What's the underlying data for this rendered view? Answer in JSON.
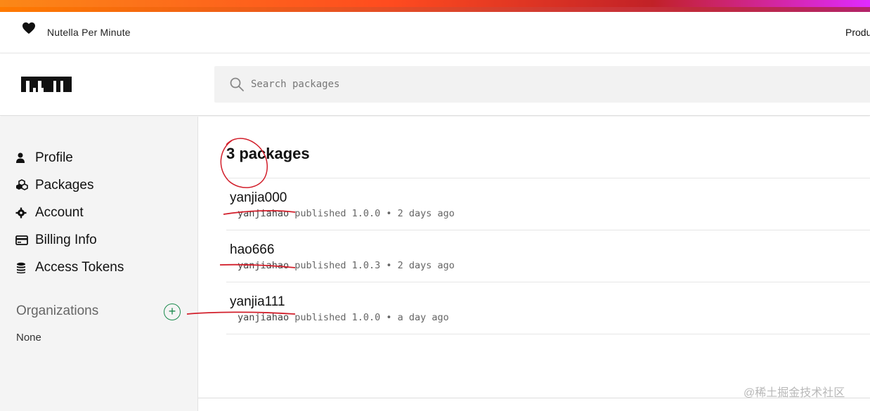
{
  "banner": {
    "title": "Nutella Per Minute",
    "right_link": "Produ"
  },
  "header": {
    "logo": "npm",
    "search": {
      "placeholder": "Search packages"
    }
  },
  "sidebar": {
    "items": [
      {
        "label": "Profile",
        "icon": "user-icon"
      },
      {
        "label": "Packages",
        "icon": "packages-icon"
      },
      {
        "label": "Account",
        "icon": "gear-icon"
      },
      {
        "label": "Billing Info",
        "icon": "credit-card-icon"
      },
      {
        "label": "Access Tokens",
        "icon": "coins-icon"
      }
    ],
    "organizations": {
      "title": "Organizations",
      "add_symbol": "+",
      "empty": "None"
    }
  },
  "main": {
    "count_label": "3 packages",
    "packages": [
      {
        "name": "yanjia000",
        "user": "yanjiahao",
        "published": "published 1.0.0 • 2 days ago"
      },
      {
        "name": "hao666",
        "user": "yanjiahao",
        "published": "published 1.0.3 • 2 days ago"
      },
      {
        "name": "yanjia111",
        "user": "yanjiahao",
        "published": "published 1.0.0 • a day ago"
      }
    ]
  },
  "watermark": "@稀土掘金技术社区",
  "colors": {
    "accent_green": "#1a8a4c",
    "annotation_red": "#d21f2b",
    "stripe_start": "#fb8817",
    "stripe_end": "#b3246a"
  }
}
